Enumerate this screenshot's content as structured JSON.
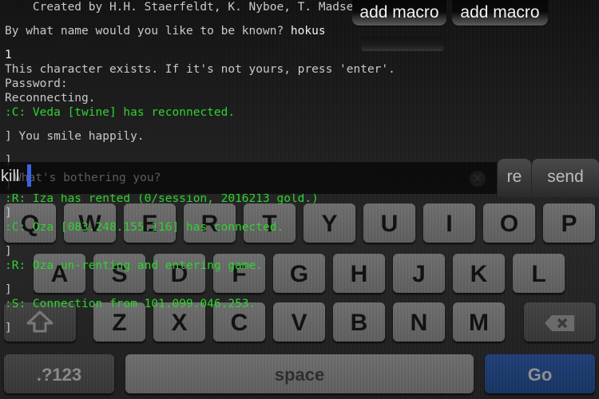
{
  "terminal": {
    "lines": [
      {
        "text": "    Created by H.H. Staerfeldt, K. Nyboe, T. Madsen",
        "color": "default"
      },
      {
        "text": "",
        "color": "gap"
      },
      {
        "text_prefix": "By what name would you like to be known? ",
        "text_highlight": "hokus"
      },
      {
        "text": "",
        "color": "gap"
      },
      {
        "text": "1",
        "color": "white"
      },
      {
        "text": "This character exists. If it's not yours, press 'enter'.",
        "color": "default"
      },
      {
        "text": "Password:",
        "color": "default"
      },
      {
        "text": "Reconnecting.",
        "color": "default"
      },
      {
        "text": ":C: Veda [twine] has reconnected.",
        "color": "green"
      },
      {
        "text": "",
        "color": "gap"
      },
      {
        "text": "] You smile happily.",
        "color": "default"
      },
      {
        "text": "",
        "color": "gap"
      },
      {
        "text": "]",
        "color": "default"
      },
      {
        "text": "",
        "color": "gap"
      },
      {
        "text": "]",
        "color": "default"
      },
      {
        "text": ":R: Iza has rented (0/session, 2016213 gold.)",
        "color": "green"
      },
      {
        "text": "]",
        "color": "default"
      },
      {
        "text": ":C: Oza [083.248.155.116] has connected.",
        "color": "green"
      },
      {
        "text": "",
        "color": "gap"
      },
      {
        "text": "]",
        "color": "default"
      },
      {
        "text": ":R: Oza un-renting and entering game.",
        "color": "green"
      },
      {
        "text": "",
        "color": "gap"
      },
      {
        "text": "]",
        "color": "default"
      },
      {
        "text": ":S: Connection from 101.099.046.253.",
        "color": "green"
      },
      {
        "text": "",
        "color": "gap"
      },
      {
        "text": "]",
        "color": "default"
      }
    ]
  },
  "macros": {
    "button_1": "add macro",
    "button_2": "add macro"
  },
  "input": {
    "value": "kill",
    "placeholder": "What's bothering you?",
    "clear_icon": "clear-circle-icon"
  },
  "actions": {
    "repeat_label": "re",
    "send_label": "send"
  },
  "keyboard": {
    "row1": [
      "Q",
      "W",
      "E",
      "R",
      "T",
      "Y",
      "U",
      "I",
      "O",
      "P"
    ],
    "row2": [
      "A",
      "S",
      "D",
      "F",
      "G",
      "H",
      "J",
      "K",
      "L"
    ],
    "row3": [
      "Z",
      "X",
      "C",
      "V",
      "B",
      "N",
      "M"
    ],
    "shift_icon": "shift-arrow-icon",
    "delete_icon": "backspace-icon",
    "numbers_label": ".?123",
    "space_label": "space",
    "go_label": "Go"
  },
  "colors": {
    "terminal_text": "#c9c9c9",
    "terminal_green": "#2fd32f",
    "caret": "#3b62e6",
    "go_key": "#1d3a70"
  }
}
